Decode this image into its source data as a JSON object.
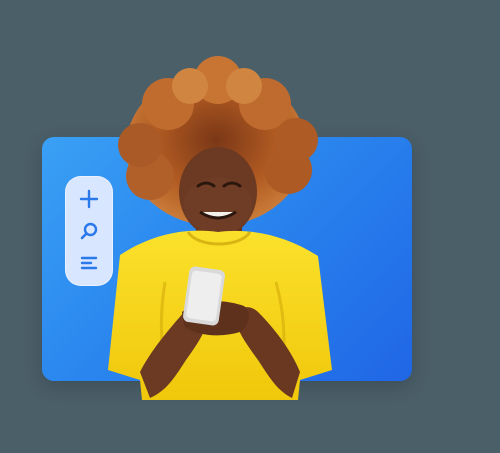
{
  "colors": {
    "background": "#4b5f69",
    "card_gradient_start": "#3aa0f5",
    "card_gradient_end": "#2066e6",
    "toolbar_bg": "#d9e6ff",
    "toolbar_icon": "#2a79ea",
    "shirt": "#f5d214",
    "hair": "#b65f25",
    "skin": "#6c3a22"
  },
  "toolbar": {
    "icons": [
      "plus-icon",
      "search-icon",
      "menu-lines-icon"
    ]
  },
  "photo": {
    "subject": "person-with-phone"
  }
}
